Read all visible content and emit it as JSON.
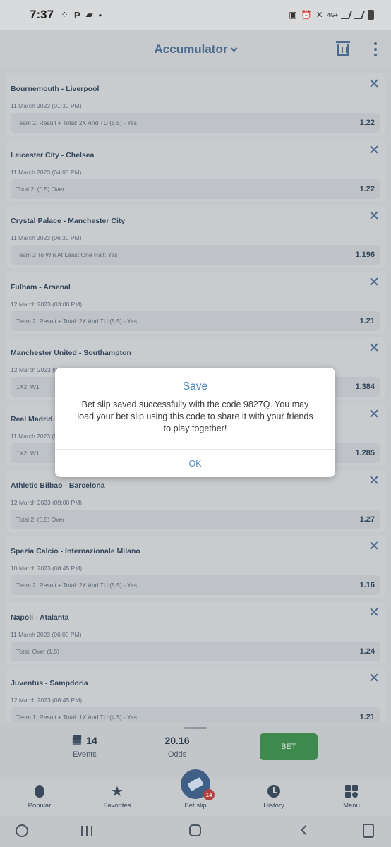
{
  "status": {
    "time": "7:37",
    "left_icons": [
      "88",
      "P",
      "chat",
      "dot"
    ],
    "right_icons": [
      "sim",
      "alarm",
      "mute",
      "4G+",
      "signal",
      "signal",
      "battery"
    ]
  },
  "header": {
    "title": "Accumulator",
    "delete_icon": "trash-icon",
    "menu_icon": "more-vert-icon"
  },
  "bets": [
    {
      "match": "Bournemouth - Liverpool",
      "date": "11 March 2023 (01:30 PM)",
      "market": "Team 2, Result + Total: 2X And TU (5.5) - Yes",
      "odds": "1.22"
    },
    {
      "match": "Leicester City - Chelsea",
      "date": "11 March 2023 (04:00 PM)",
      "market": "Total 2: (0.5) Over",
      "odds": "1.22"
    },
    {
      "match": "Crystal Palace - Manchester City",
      "date": "11 March 2023 (06:30 PM)",
      "market": "Team 2 To Win At Least One Half: Yes",
      "odds": "1.196"
    },
    {
      "match": "Fulham - Arsenal",
      "date": "12 March 2023 (03:00 PM)",
      "market": "Team 2, Result + Total: 2X And TU (5.5) - Yes",
      "odds": "1.21"
    },
    {
      "match": "Manchester United - Southampton",
      "date": "12 March 2023 (03:00 PM)",
      "market": "1X2: W1",
      "odds": "1.384"
    },
    {
      "match": "Real Madrid - Espanyol",
      "date": "11 March 2023 (09:00 PM)",
      "market": "1X2: W1",
      "odds": "1.285"
    },
    {
      "match": "Athletic Bilbao - Barcelona",
      "date": "12 March 2023 (09:00 PM)",
      "market": "Total 2: (0.5) Over",
      "odds": "1.27"
    },
    {
      "match": "Spezia Calcio - Internazionale Milano",
      "date": "10 March 2023 (08:45 PM)",
      "market": "Team 2, Result + Total: 2X And TU (5.5) - Yes",
      "odds": "1.16"
    },
    {
      "match": "Napoli - Atalanta",
      "date": "11 March 2023 (06:00 PM)",
      "market": "Total: Over (1.5)",
      "odds": "1.24"
    },
    {
      "match": "Juventus - Sampdoria",
      "date": "12 March 2023 (08:45 PM)",
      "market": "Team 1, Result + Total: 1X And TU (4.5) - Yes",
      "odds": "1.21"
    }
  ],
  "summary": {
    "events_count": "14",
    "events_label": "Events",
    "odds_value": "20.16",
    "odds_label": "Odds",
    "bet_label": "BET",
    "bet_color": "#3e8a4e"
  },
  "tabs": [
    {
      "label": "Popular",
      "icon": "flame-icon"
    },
    {
      "label": "Favorites",
      "icon": "star-icon"
    },
    {
      "label": "Bet slip",
      "icon": "ticket-icon",
      "badge": "14"
    },
    {
      "label": "History",
      "icon": "clock-icon"
    },
    {
      "label": "Menu",
      "icon": "grid-icon"
    }
  ],
  "modal": {
    "title": "Save",
    "message": "Bet slip saved successfully with the code 9827Q. You may load your bet slip using this code to share it with your friends to play together!",
    "ok_label": "OK",
    "accent": "#4a86c0"
  }
}
